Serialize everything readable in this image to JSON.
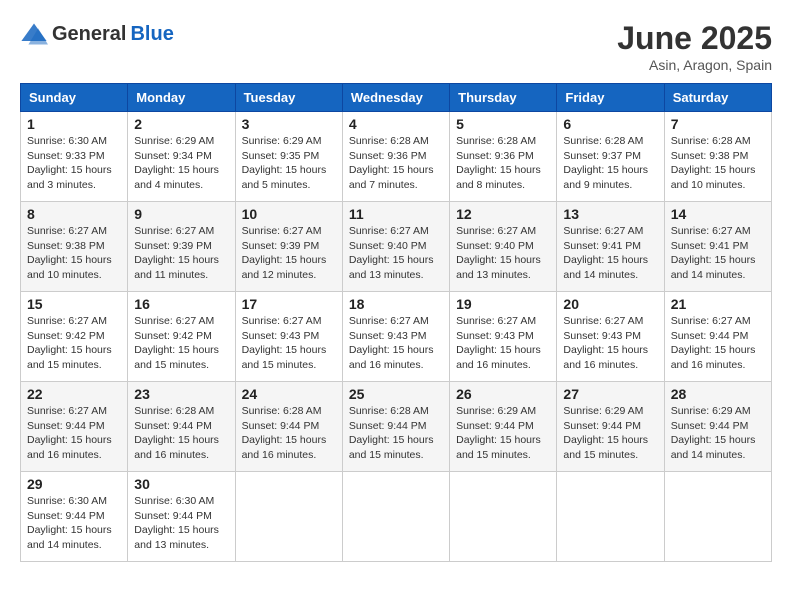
{
  "header": {
    "logo_general": "General",
    "logo_blue": "Blue",
    "title": "June 2025",
    "location": "Asin, Aragon, Spain"
  },
  "days_of_week": [
    "Sunday",
    "Monday",
    "Tuesday",
    "Wednesday",
    "Thursday",
    "Friday",
    "Saturday"
  ],
  "weeks": [
    [
      {
        "day": "1",
        "sunrise": "6:30 AM",
        "sunset": "9:33 PM",
        "daylight": "15 hours and 3 minutes."
      },
      {
        "day": "2",
        "sunrise": "6:29 AM",
        "sunset": "9:34 PM",
        "daylight": "15 hours and 4 minutes."
      },
      {
        "day": "3",
        "sunrise": "6:29 AM",
        "sunset": "9:35 PM",
        "daylight": "15 hours and 5 minutes."
      },
      {
        "day": "4",
        "sunrise": "6:28 AM",
        "sunset": "9:36 PM",
        "daylight": "15 hours and 7 minutes."
      },
      {
        "day": "5",
        "sunrise": "6:28 AM",
        "sunset": "9:36 PM",
        "daylight": "15 hours and 8 minutes."
      },
      {
        "day": "6",
        "sunrise": "6:28 AM",
        "sunset": "9:37 PM",
        "daylight": "15 hours and 9 minutes."
      },
      {
        "day": "7",
        "sunrise": "6:28 AM",
        "sunset": "9:38 PM",
        "daylight": "15 hours and 10 minutes."
      }
    ],
    [
      {
        "day": "8",
        "sunrise": "6:27 AM",
        "sunset": "9:38 PM",
        "daylight": "15 hours and 10 minutes."
      },
      {
        "day": "9",
        "sunrise": "6:27 AM",
        "sunset": "9:39 PM",
        "daylight": "15 hours and 11 minutes."
      },
      {
        "day": "10",
        "sunrise": "6:27 AM",
        "sunset": "9:39 PM",
        "daylight": "15 hours and 12 minutes."
      },
      {
        "day": "11",
        "sunrise": "6:27 AM",
        "sunset": "9:40 PM",
        "daylight": "15 hours and 13 minutes."
      },
      {
        "day": "12",
        "sunrise": "6:27 AM",
        "sunset": "9:40 PM",
        "daylight": "15 hours and 13 minutes."
      },
      {
        "day": "13",
        "sunrise": "6:27 AM",
        "sunset": "9:41 PM",
        "daylight": "15 hours and 14 minutes."
      },
      {
        "day": "14",
        "sunrise": "6:27 AM",
        "sunset": "9:41 PM",
        "daylight": "15 hours and 14 minutes."
      }
    ],
    [
      {
        "day": "15",
        "sunrise": "6:27 AM",
        "sunset": "9:42 PM",
        "daylight": "15 hours and 15 minutes."
      },
      {
        "day": "16",
        "sunrise": "6:27 AM",
        "sunset": "9:42 PM",
        "daylight": "15 hours and 15 minutes."
      },
      {
        "day": "17",
        "sunrise": "6:27 AM",
        "sunset": "9:43 PM",
        "daylight": "15 hours and 15 minutes."
      },
      {
        "day": "18",
        "sunrise": "6:27 AM",
        "sunset": "9:43 PM",
        "daylight": "15 hours and 16 minutes."
      },
      {
        "day": "19",
        "sunrise": "6:27 AM",
        "sunset": "9:43 PM",
        "daylight": "15 hours and 16 minutes."
      },
      {
        "day": "20",
        "sunrise": "6:27 AM",
        "sunset": "9:43 PM",
        "daylight": "15 hours and 16 minutes."
      },
      {
        "day": "21",
        "sunrise": "6:27 AM",
        "sunset": "9:44 PM",
        "daylight": "15 hours and 16 minutes."
      }
    ],
    [
      {
        "day": "22",
        "sunrise": "6:27 AM",
        "sunset": "9:44 PM",
        "daylight": "15 hours and 16 minutes."
      },
      {
        "day": "23",
        "sunrise": "6:28 AM",
        "sunset": "9:44 PM",
        "daylight": "15 hours and 16 minutes."
      },
      {
        "day": "24",
        "sunrise": "6:28 AM",
        "sunset": "9:44 PM",
        "daylight": "15 hours and 16 minutes."
      },
      {
        "day": "25",
        "sunrise": "6:28 AM",
        "sunset": "9:44 PM",
        "daylight": "15 hours and 15 minutes."
      },
      {
        "day": "26",
        "sunrise": "6:29 AM",
        "sunset": "9:44 PM",
        "daylight": "15 hours and 15 minutes."
      },
      {
        "day": "27",
        "sunrise": "6:29 AM",
        "sunset": "9:44 PM",
        "daylight": "15 hours and 15 minutes."
      },
      {
        "day": "28",
        "sunrise": "6:29 AM",
        "sunset": "9:44 PM",
        "daylight": "15 hours and 14 minutes."
      }
    ],
    [
      {
        "day": "29",
        "sunrise": "6:30 AM",
        "sunset": "9:44 PM",
        "daylight": "15 hours and 14 minutes."
      },
      {
        "day": "30",
        "sunrise": "6:30 AM",
        "sunset": "9:44 PM",
        "daylight": "15 hours and 13 minutes."
      },
      null,
      null,
      null,
      null,
      null
    ]
  ]
}
